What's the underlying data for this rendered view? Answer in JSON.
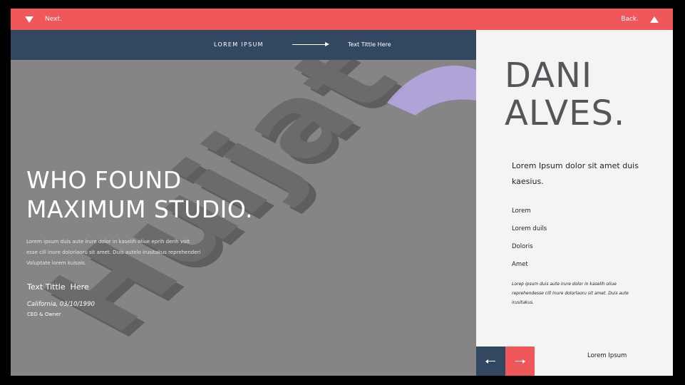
{
  "topbar": {
    "next_label": "Next.",
    "back_label": "Back."
  },
  "navbar": {
    "lorem_label": "LOREM IPSUM",
    "title_label": "Text Tittle Here"
  },
  "graphic": {
    "word": "Huijat"
  },
  "left": {
    "headline": [
      "WHO FOUND",
      "MAXIMUM STUDIO."
    ],
    "intro": "Lorem  ipsum duis aute irure dolor in kaselih oliue eprih derih volt esse cill inure dolorlaoru sit amet. Duis autelo irusitakus reprehenderi Voluptate lorem kuisais.",
    "text_title": "Text Tittle  Here",
    "location": "California, 03/10/1990",
    "role": "CEO & Owner"
  },
  "right": {
    "name": [
      "DANI",
      "ALVES."
    ],
    "lead": "Lorem Ipsum dolor sit amet duis kaesius.",
    "list": [
      "Lorem",
      "Lorem duils",
      "Doloris",
      "Amet"
    ],
    "note": "Lorep  ipsum duis aute irure dolor in kaselih oliue reprehendesse cill inure dolorlaoru sit amet. Duis aute irusitakus."
  },
  "footer": {
    "text": "Lorem Ipsum"
  },
  "colors": {
    "accent": "#f0575a",
    "navy": "#324861",
    "panel": "#f4f4f4",
    "background": "#858585"
  },
  "icons": {
    "next": "triangle-down-icon",
    "back": "triangle-up-icon",
    "prev_arrow": "arrow-left-icon",
    "next_arrow": "arrow-right-icon"
  }
}
